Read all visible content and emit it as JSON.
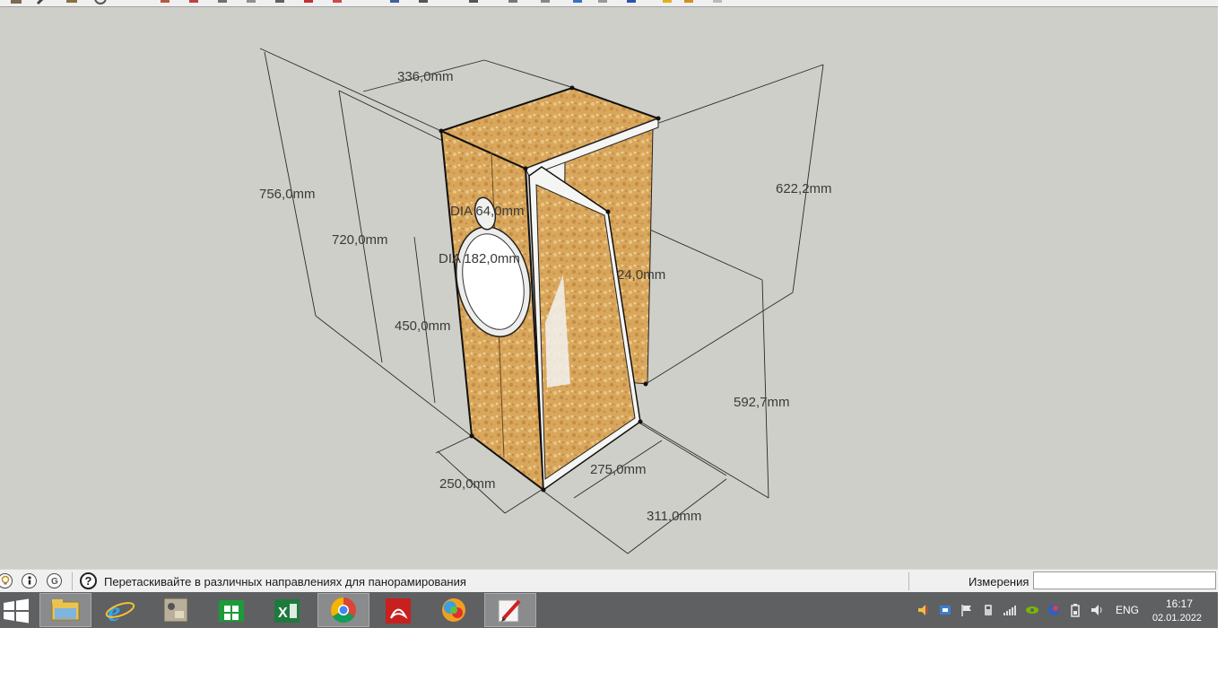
{
  "viewport": {
    "dimensions": {
      "width_top": "336,0mm",
      "height_outer": "756,0mm",
      "height_inner": "720,0mm",
      "driver_height": "450,0mm",
      "tweeter_dia": "DIA 64,0mm",
      "woofer_dia": "DIA 182,0mm",
      "panel_thickness": "24,0mm",
      "height_back": "622,2mm",
      "height_port": "592,7mm",
      "depth_bottom": "250,0mm",
      "inner_depth": "275,0mm",
      "outer_depth": "311,0mm"
    }
  },
  "statusbar": {
    "icons": [
      "lightbulb-icon",
      "info-person-icon",
      "geo-location-icon",
      "help-icon"
    ],
    "help_symbol": "?",
    "message": "Перетаскивайте в различных направлениях для панорамирования",
    "measure_label": "Измерения",
    "measure_value": ""
  },
  "taskbar": {
    "apps": [
      {
        "name": "file-explorer-icon",
        "active": true
      },
      {
        "name": "internet-explorer-icon",
        "active": false
      },
      {
        "name": "control-panel-icon",
        "active": false
      },
      {
        "name": "windows-store-icon",
        "active": false
      },
      {
        "name": "excel-icon",
        "active": false
      },
      {
        "name": "chrome-icon",
        "active": true
      },
      {
        "name": "acrobat-icon",
        "active": false
      },
      {
        "name": "photo-app-icon",
        "active": false
      },
      {
        "name": "sketchup-icon",
        "active": true
      }
    ],
    "tray": {
      "language": "ENG",
      "time": "16:17",
      "date": "02.01.2022"
    }
  },
  "colors": {
    "viewport_bg": "#cfcfca",
    "wood": "#d9a75c",
    "taskbar": "#5f6062"
  }
}
